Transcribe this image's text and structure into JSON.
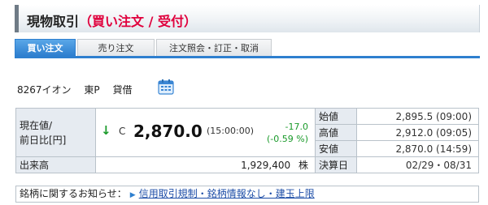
{
  "header": {
    "title": "現物取引",
    "subtitle": "（買い注文 / 受付）"
  },
  "tabs": [
    {
      "label": "買い注文",
      "active": true
    },
    {
      "label": "売り注文",
      "active": false
    },
    {
      "label": "注文照会・訂正・取消",
      "active": false
    }
  ],
  "stock": {
    "code_name": "8267イオン",
    "market": "東P",
    "margin": "貸借"
  },
  "quote": {
    "current_label_1": "現在値/",
    "current_label_2": "前日比[円]",
    "direction": "↓",
    "mark": "C",
    "price": "2,870.0",
    "price_time": "(15:00:00)",
    "change": "-17.0",
    "change_pct": "(-0.59 %)",
    "volume_label": "出来高",
    "volume_value": "1,929,400",
    "volume_unit": "株",
    "open_label": "始値",
    "open_value": "2,895.5 (09:00)",
    "high_label": "高値",
    "high_value": "2,912.0 (09:05)",
    "low_label": "安値",
    "low_value": "2,870.0 (14:59)",
    "settle_label": "決算日",
    "settle_value": "02/29・08/31"
  },
  "notice": {
    "label": "銘柄に関するお知らせ：",
    "link": "信用取引規制・銘柄情報なし・建玉上限"
  },
  "colors": {
    "accent": "#2e7fcf",
    "down": "#1a9a2a",
    "subtitle": "#e0003c"
  }
}
